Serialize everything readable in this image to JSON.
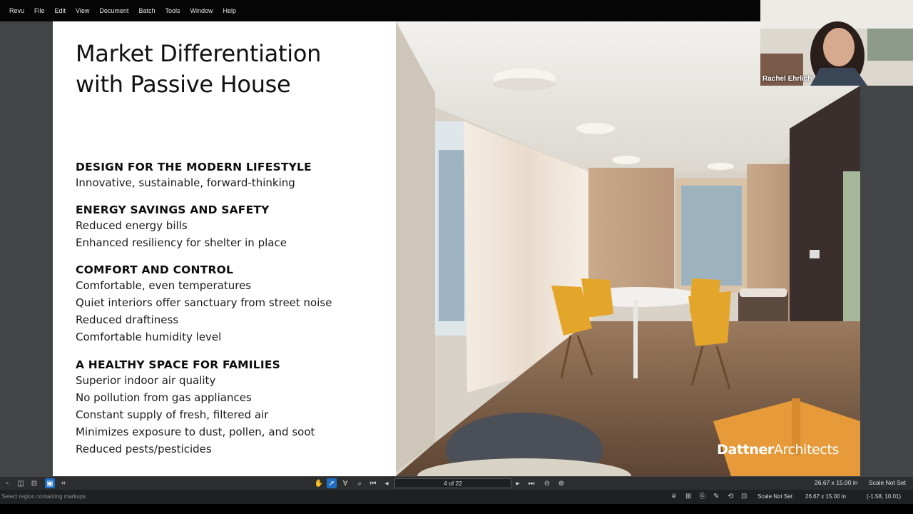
{
  "menu": [
    "Revu",
    "File",
    "Edit",
    "View",
    "Document",
    "Batch",
    "Tools",
    "Window",
    "Help"
  ],
  "slide": {
    "title_line1": "Market Differentiation",
    "title_line2": "with Passive House",
    "sections": [
      {
        "heading": "DESIGN FOR THE MODERN LIFESTYLE",
        "items": [
          "Innovative, sustainable, forward-thinking"
        ]
      },
      {
        "heading": "ENERGY SAVINGS AND SAFETY",
        "items": [
          "Reduced energy bills",
          "Enhanced resiliency for shelter in place"
        ]
      },
      {
        "heading": "COMFORT AND CONTROL",
        "items": [
          "Comfortable, even temperatures",
          "Quiet interiors offer sanctuary from street noise",
          "Reduced draftiness",
          "Comfortable humidity level"
        ]
      },
      {
        "heading": "A HEALTHY SPACE FOR FAMILIES",
        "items": [
          "Superior indoor air quality",
          "No pollution from gas appliances",
          "Constant supply of fresh, filtered air",
          "Minimizes exposure to dust, pollen, and soot",
          "Reduced pests/pesticides"
        ]
      }
    ],
    "brand_bold": "Dattner",
    "brand_regular": "Architects"
  },
  "video": {
    "participant_name": "Rachel Ehrlich"
  },
  "toolbar": {
    "page_indicator": "4 of 22",
    "dimensions": "26.67 x 15.00 in",
    "scale": "Scale Not Set"
  },
  "status": {
    "hint": "Select region containing markups",
    "scale": "Scale Not Set",
    "dimensions": "26.67 x 15.00 in",
    "coordinates": "(-1.58, 10.01)"
  },
  "colors": {
    "accent": "#1f6fc1",
    "chair": "#e3a52a"
  }
}
